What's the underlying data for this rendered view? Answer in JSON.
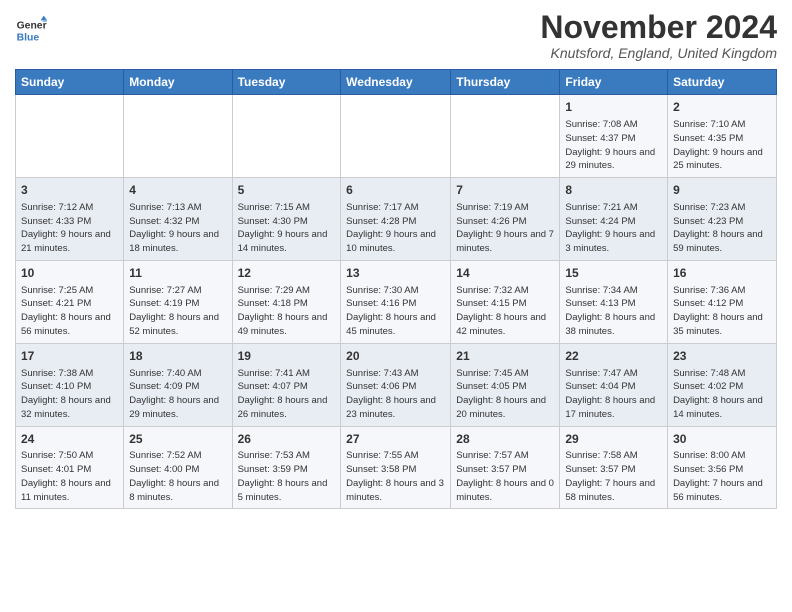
{
  "logo": {
    "line1": "General",
    "line2": "Blue"
  },
  "title": "November 2024",
  "location": "Knutsford, England, United Kingdom",
  "days_of_week": [
    "Sunday",
    "Monday",
    "Tuesday",
    "Wednesday",
    "Thursday",
    "Friday",
    "Saturday"
  ],
  "weeks": [
    [
      {
        "day": "",
        "info": ""
      },
      {
        "day": "",
        "info": ""
      },
      {
        "day": "",
        "info": ""
      },
      {
        "day": "",
        "info": ""
      },
      {
        "day": "",
        "info": ""
      },
      {
        "day": "1",
        "info": "Sunrise: 7:08 AM\nSunset: 4:37 PM\nDaylight: 9 hours and 29 minutes."
      },
      {
        "day": "2",
        "info": "Sunrise: 7:10 AM\nSunset: 4:35 PM\nDaylight: 9 hours and 25 minutes."
      }
    ],
    [
      {
        "day": "3",
        "info": "Sunrise: 7:12 AM\nSunset: 4:33 PM\nDaylight: 9 hours and 21 minutes."
      },
      {
        "day": "4",
        "info": "Sunrise: 7:13 AM\nSunset: 4:32 PM\nDaylight: 9 hours and 18 minutes."
      },
      {
        "day": "5",
        "info": "Sunrise: 7:15 AM\nSunset: 4:30 PM\nDaylight: 9 hours and 14 minutes."
      },
      {
        "day": "6",
        "info": "Sunrise: 7:17 AM\nSunset: 4:28 PM\nDaylight: 9 hours and 10 minutes."
      },
      {
        "day": "7",
        "info": "Sunrise: 7:19 AM\nSunset: 4:26 PM\nDaylight: 9 hours and 7 minutes."
      },
      {
        "day": "8",
        "info": "Sunrise: 7:21 AM\nSunset: 4:24 PM\nDaylight: 9 hours and 3 minutes."
      },
      {
        "day": "9",
        "info": "Sunrise: 7:23 AM\nSunset: 4:23 PM\nDaylight: 8 hours and 59 minutes."
      }
    ],
    [
      {
        "day": "10",
        "info": "Sunrise: 7:25 AM\nSunset: 4:21 PM\nDaylight: 8 hours and 56 minutes."
      },
      {
        "day": "11",
        "info": "Sunrise: 7:27 AM\nSunset: 4:19 PM\nDaylight: 8 hours and 52 minutes."
      },
      {
        "day": "12",
        "info": "Sunrise: 7:29 AM\nSunset: 4:18 PM\nDaylight: 8 hours and 49 minutes."
      },
      {
        "day": "13",
        "info": "Sunrise: 7:30 AM\nSunset: 4:16 PM\nDaylight: 8 hours and 45 minutes."
      },
      {
        "day": "14",
        "info": "Sunrise: 7:32 AM\nSunset: 4:15 PM\nDaylight: 8 hours and 42 minutes."
      },
      {
        "day": "15",
        "info": "Sunrise: 7:34 AM\nSunset: 4:13 PM\nDaylight: 8 hours and 38 minutes."
      },
      {
        "day": "16",
        "info": "Sunrise: 7:36 AM\nSunset: 4:12 PM\nDaylight: 8 hours and 35 minutes."
      }
    ],
    [
      {
        "day": "17",
        "info": "Sunrise: 7:38 AM\nSunset: 4:10 PM\nDaylight: 8 hours and 32 minutes."
      },
      {
        "day": "18",
        "info": "Sunrise: 7:40 AM\nSunset: 4:09 PM\nDaylight: 8 hours and 29 minutes."
      },
      {
        "day": "19",
        "info": "Sunrise: 7:41 AM\nSunset: 4:07 PM\nDaylight: 8 hours and 26 minutes."
      },
      {
        "day": "20",
        "info": "Sunrise: 7:43 AM\nSunset: 4:06 PM\nDaylight: 8 hours and 23 minutes."
      },
      {
        "day": "21",
        "info": "Sunrise: 7:45 AM\nSunset: 4:05 PM\nDaylight: 8 hours and 20 minutes."
      },
      {
        "day": "22",
        "info": "Sunrise: 7:47 AM\nSunset: 4:04 PM\nDaylight: 8 hours and 17 minutes."
      },
      {
        "day": "23",
        "info": "Sunrise: 7:48 AM\nSunset: 4:02 PM\nDaylight: 8 hours and 14 minutes."
      }
    ],
    [
      {
        "day": "24",
        "info": "Sunrise: 7:50 AM\nSunset: 4:01 PM\nDaylight: 8 hours and 11 minutes."
      },
      {
        "day": "25",
        "info": "Sunrise: 7:52 AM\nSunset: 4:00 PM\nDaylight: 8 hours and 8 minutes."
      },
      {
        "day": "26",
        "info": "Sunrise: 7:53 AM\nSunset: 3:59 PM\nDaylight: 8 hours and 5 minutes."
      },
      {
        "day": "27",
        "info": "Sunrise: 7:55 AM\nSunset: 3:58 PM\nDaylight: 8 hours and 3 minutes."
      },
      {
        "day": "28",
        "info": "Sunrise: 7:57 AM\nSunset: 3:57 PM\nDaylight: 8 hours and 0 minutes."
      },
      {
        "day": "29",
        "info": "Sunrise: 7:58 AM\nSunset: 3:57 PM\nDaylight: 7 hours and 58 minutes."
      },
      {
        "day": "30",
        "info": "Sunrise: 8:00 AM\nSunset: 3:56 PM\nDaylight: 7 hours and 56 minutes."
      }
    ]
  ]
}
